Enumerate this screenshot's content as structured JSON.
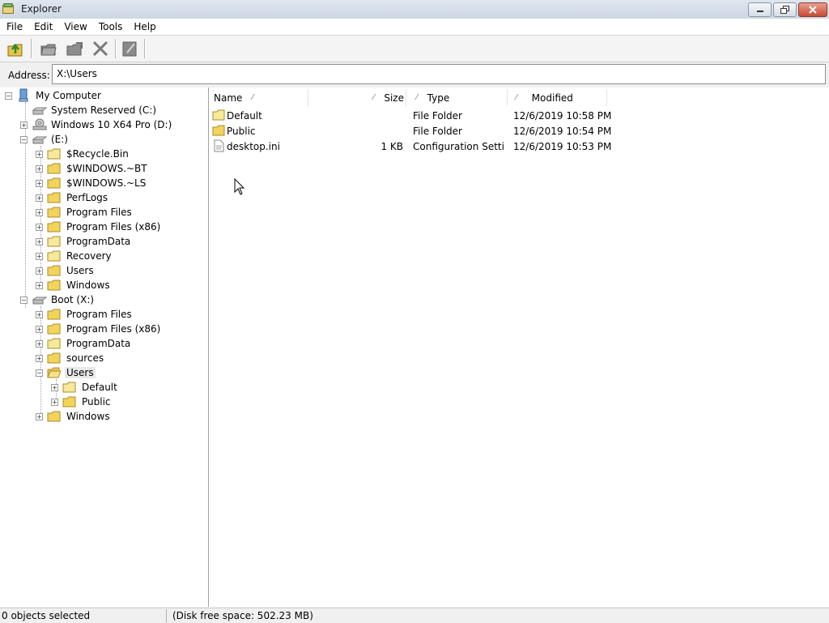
{
  "window": {
    "title": "Explorer"
  },
  "menu": [
    "File",
    "Edit",
    "View",
    "Tools",
    "Help"
  ],
  "toolbar": {
    "buttons": [
      {
        "icon": "up-folder-icon"
      },
      {
        "icon": "copy-icon"
      },
      {
        "icon": "move-icon"
      },
      {
        "icon": "delete-icon"
      },
      {
        "icon": "properties-icon"
      }
    ]
  },
  "address": {
    "label": "Address:",
    "value": "X:\\Users"
  },
  "tree": {
    "items": [
      {
        "label": "My Computer"
      },
      {
        "label": "System Reserved (C:)"
      },
      {
        "label": "Windows 10 X64 Pro (D:)"
      },
      {
        "label": "(E:)"
      },
      {
        "label": "$Recycle.Bin"
      },
      {
        "label": "$WINDOWS.~BT"
      },
      {
        "label": "$WINDOWS.~LS"
      },
      {
        "label": "PerfLogs"
      },
      {
        "label": "Program Files"
      },
      {
        "label": "Program Files (x86)"
      },
      {
        "label": "ProgramData"
      },
      {
        "label": "Recovery"
      },
      {
        "label": "Users"
      },
      {
        "label": "Windows"
      },
      {
        "label": "Boot (X:)"
      },
      {
        "label": "Program Files"
      },
      {
        "label": "Program Files (x86)"
      },
      {
        "label": "ProgramData"
      },
      {
        "label": "sources"
      },
      {
        "label": "Users"
      },
      {
        "label": "Default"
      },
      {
        "label": "Public"
      },
      {
        "label": "Windows"
      }
    ]
  },
  "list": {
    "columns": [
      "Name",
      "Size",
      "Type",
      "Modified"
    ],
    "rows": [
      {
        "name": "Default",
        "size": "",
        "type": "File Folder",
        "modified": "12/6/2019 10:58 PM"
      },
      {
        "name": "Public",
        "size": "",
        "type": "File Folder",
        "modified": "12/6/2019 10:54 PM"
      },
      {
        "name": "desktop.ini",
        "size": "1 KB",
        "type": "Configuration Setti...",
        "modified": "12/6/2019 10:53 PM"
      }
    ]
  },
  "status": {
    "selection": "0 objects selected",
    "free_space": "(Disk free space: 502.23 MB)"
  }
}
